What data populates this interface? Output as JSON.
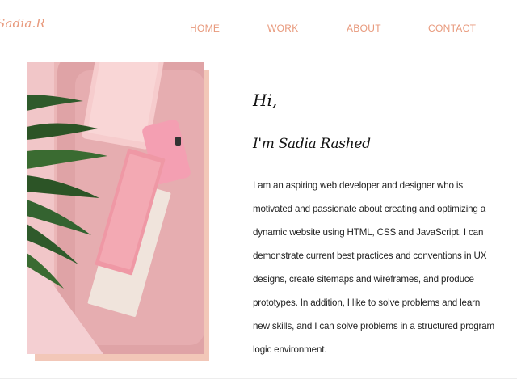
{
  "brand": {
    "logo": "Sadia.R"
  },
  "nav": {
    "home": "HOME",
    "work": "WORK",
    "about": "ABOUT",
    "contact": "CONTACT"
  },
  "hero": {
    "greeting": "Hi,",
    "name": "I'm Sadia Rashed",
    "bio": "I am an aspiring web developer and designer who is motivated and passionate about creating and optimizing a dynamic website using HTML, CSS and JavaScript. I can demonstrate current best practices and conventions in UX designs, create sitemaps and wireframes, and produce prototypes. In addition, I like to solve problems and learn new skills, and I can solve problems in a structured program logic environment."
  },
  "colors": {
    "accent": "#e8997c",
    "photo_shadow": "#f2c7b8",
    "photo_base": "#e9b4b6"
  },
  "icons": {
    "photo": "pink-desk-flatlay-image"
  }
}
